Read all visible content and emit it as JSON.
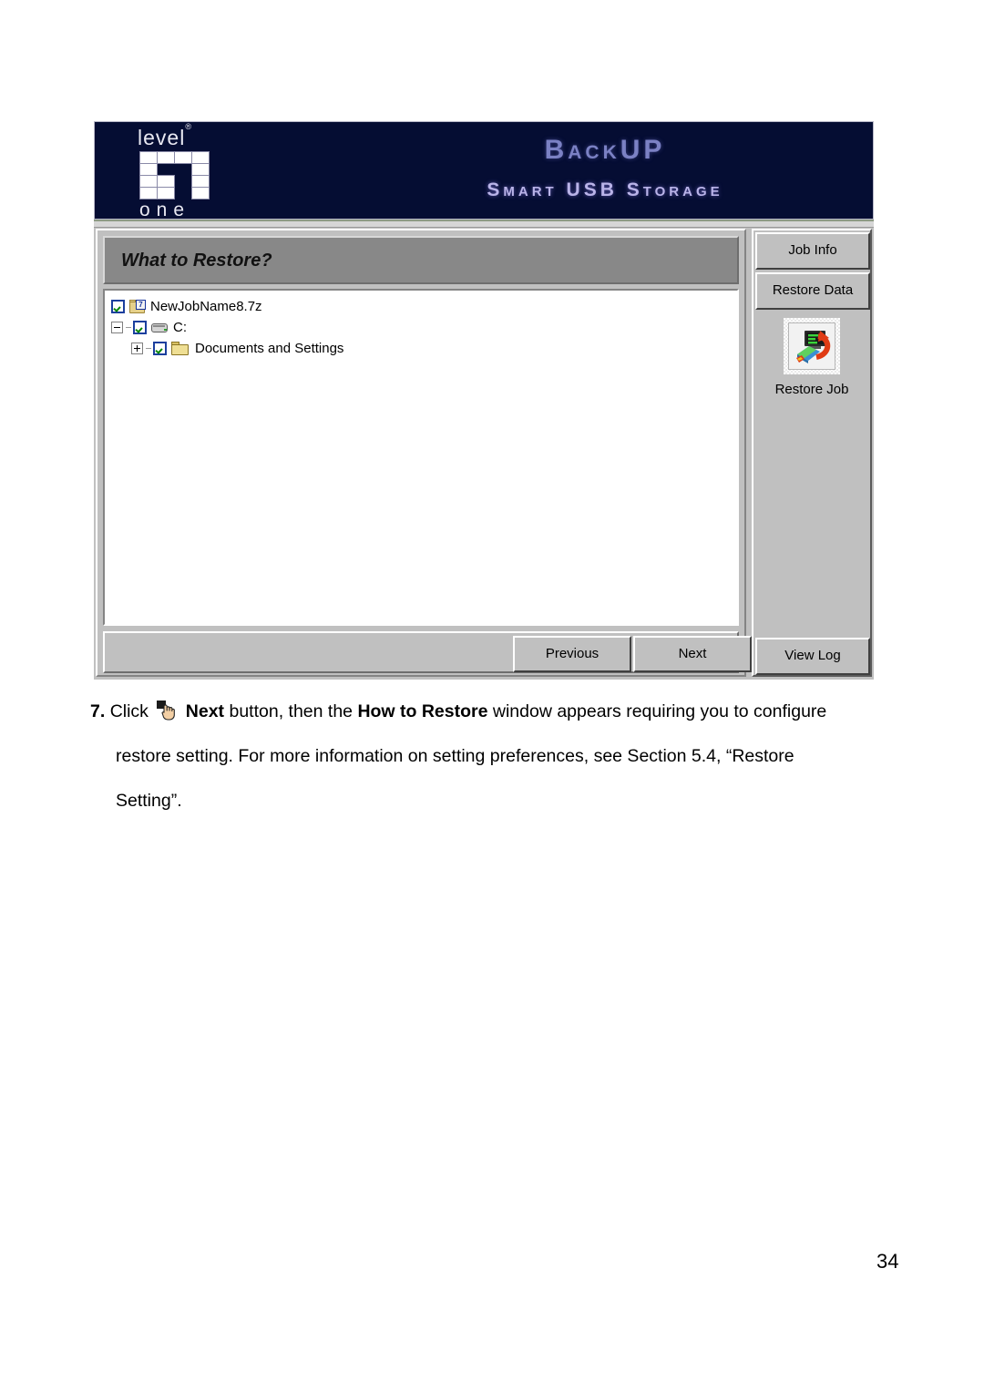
{
  "app": {
    "banner": {
      "logo": {
        "word_top": "level",
        "registered": "®",
        "word_bottom": "one"
      },
      "title": "BackUP",
      "subtitle": "Smart USB Storage"
    },
    "panel": {
      "header_title": "What to Restore?",
      "tree": [
        {
          "label": "NewJobName8.7z",
          "icon": "archive-7z-icon",
          "checked": true,
          "depth": 0,
          "expander": "none"
        },
        {
          "label": "C:",
          "icon": "drive-icon",
          "checked": true,
          "depth": 0,
          "expander": "minus"
        },
        {
          "label": "Documents and Settings",
          "icon": "folder-icon",
          "checked": true,
          "depth": 1,
          "expander": "plus"
        }
      ],
      "buttons": {
        "previous": "Previous",
        "next": "Next"
      }
    },
    "sidebar": {
      "job_info": "Job Info",
      "restore_data": "Restore Data",
      "restore_job": "Restore Job",
      "view_log": "View Log"
    },
    "colors": {
      "banner_bg": "#050d33",
      "banner_title": "#7b81c4",
      "banner_subtitle": "#b9b3e8",
      "window_face": "#c0c0c0",
      "header_bar": "#888888",
      "checkbox_border": "#1b3f9e",
      "checkmark": "#068606"
    }
  },
  "document": {
    "step_number": "7.",
    "text_part_1": "Click",
    "cursor_icon": "hand-pointer-icon",
    "bold_next": "Next",
    "text_part_2": "button, then the",
    "bold_how_to_restore": "How to Restore",
    "text_part_3": "window appears requiring you to configure",
    "text_line_2": "restore setting. For more information on setting preferences, see Section 5.4, “Restore",
    "text_line_3": "Setting”.",
    "page_number": "34"
  }
}
